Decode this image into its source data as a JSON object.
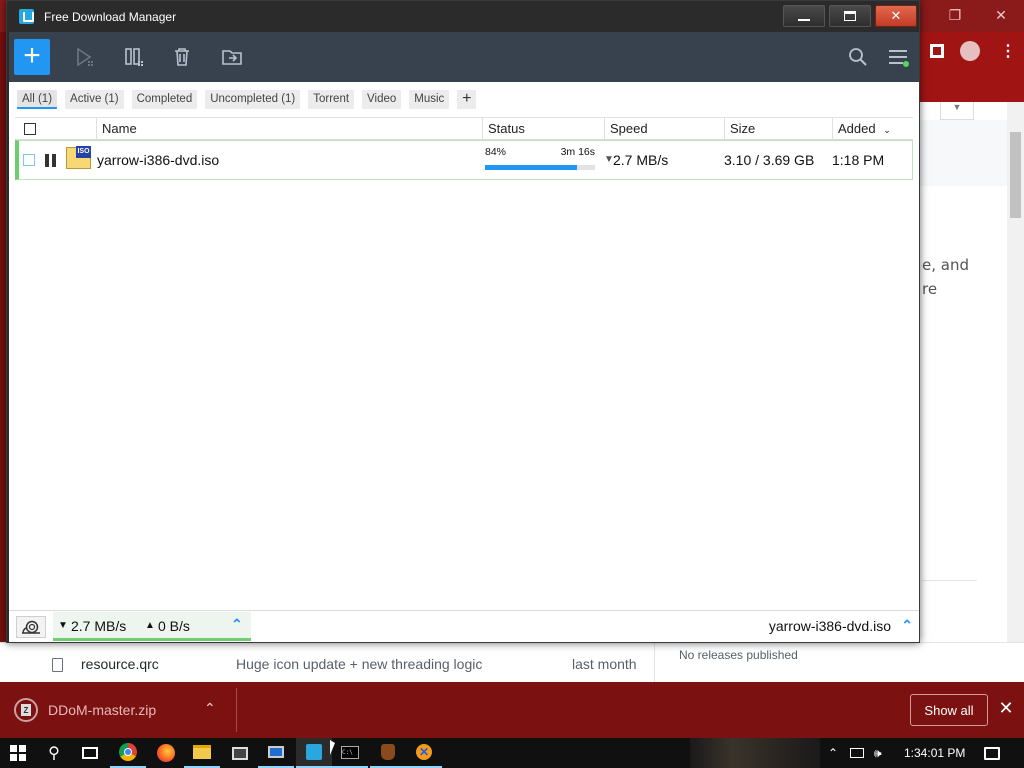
{
  "app": {
    "title": "Free Download Manager"
  },
  "toolbar": {
    "add_label": "+",
    "icons": [
      "add-download",
      "start-icon",
      "pause-all-icon",
      "delete-icon",
      "move-folder-icon",
      "search-icon",
      "menu-icon"
    ]
  },
  "tabs": [
    {
      "label": "All (1)",
      "active": true
    },
    {
      "label": "Active (1)"
    },
    {
      "label": "Completed"
    },
    {
      "label": "Uncompleted (1)"
    },
    {
      "label": "Torrent"
    },
    {
      "label": "Video"
    },
    {
      "label": "Music"
    }
  ],
  "tab_add_label": "+",
  "columns": {
    "name": "Name",
    "status": "Status",
    "speed": "Speed",
    "size": "Size",
    "added": "Added"
  },
  "downloads": [
    {
      "name": "yarrow-i386-dvd.iso",
      "icon_badge": "ISO",
      "progress_label": "84%",
      "progress_fraction": 0.84,
      "eta": "3m 16s",
      "speed": "2.7 MB/s",
      "size": "3.10 / 3.69 GB",
      "added": "1:18 PM"
    }
  ],
  "statusbar": {
    "download_speed": "2.7 MB/s",
    "upload_speed": "0 B/s",
    "current_file": "yarrow-i386-dvd.iso"
  },
  "background_page": {
    "text_line1": "e, and",
    "text_line2": "re",
    "file_name": "resource.qrc",
    "commit_message": "Huge icon update + new threading logic",
    "commit_time": "last month",
    "releases": "No releases published"
  },
  "download_shelf": {
    "file": "DDoM-master.zip",
    "show_all": "Show all"
  },
  "taskbar": {
    "clock": "1:34:01 PM"
  },
  "colors": {
    "accent": "#2196f3",
    "toolbar_bg": "#38424f",
    "active_row": "#6fce6f",
    "close_button": "#c43b26"
  }
}
